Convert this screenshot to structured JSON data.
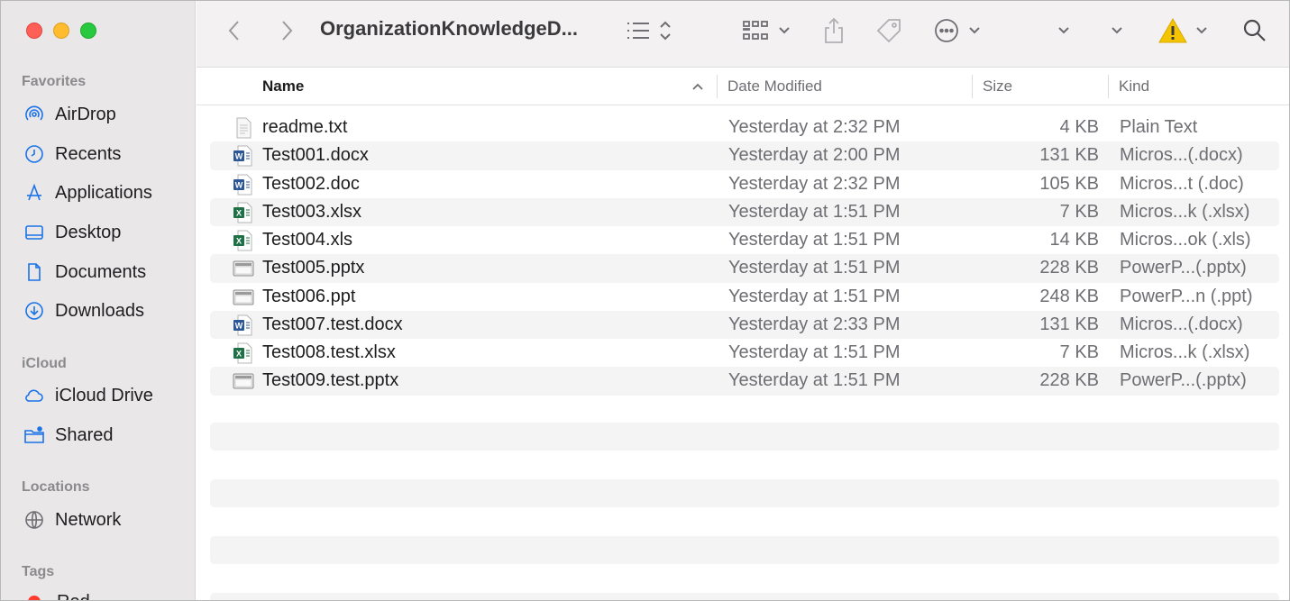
{
  "window": {
    "title": "OrganizationKnowledgeD..."
  },
  "sidebar": {
    "sections": [
      {
        "label": "Favorites"
      },
      {
        "label": "iCloud"
      },
      {
        "label": "Locations"
      },
      {
        "label": "Tags"
      }
    ],
    "favorites": [
      {
        "label": "AirDrop",
        "icon": "airdrop-icon"
      },
      {
        "label": "Recents",
        "icon": "clock-icon"
      },
      {
        "label": "Applications",
        "icon": "applications-icon"
      },
      {
        "label": "Desktop",
        "icon": "desktop-icon"
      },
      {
        "label": "Documents",
        "icon": "document-icon"
      },
      {
        "label": "Downloads",
        "icon": "download-icon"
      }
    ],
    "icloud": [
      {
        "label": "iCloud Drive",
        "icon": "cloud-icon"
      },
      {
        "label": "Shared",
        "icon": "shared-folder-icon"
      }
    ],
    "locations": [
      {
        "label": "Network",
        "icon": "globe-icon"
      }
    ],
    "tags": [
      {
        "label": "Red",
        "color": "#ff3b30"
      }
    ]
  },
  "columns": {
    "name": "Name",
    "date": "Date Modified",
    "size": "Size",
    "kind": "Kind"
  },
  "files": [
    {
      "name": "readme.txt",
      "date": "Yesterday at 2:32 PM",
      "size": "4 KB",
      "kind": "Plain Text",
      "icon": "text-file-icon"
    },
    {
      "name": "Test001.docx",
      "date": "Yesterday at 2:00 PM",
      "size": "131 KB",
      "kind": "Micros...(.docx)",
      "icon": "word-file-icon"
    },
    {
      "name": "Test002.doc",
      "date": "Yesterday at 2:32 PM",
      "size": "105 KB",
      "kind": "Micros...t (.doc)",
      "icon": "word-file-icon"
    },
    {
      "name": "Test003.xlsx",
      "date": "Yesterday at 1:51 PM",
      "size": "7 KB",
      "kind": "Micros...k (.xlsx)",
      "icon": "excel-file-icon"
    },
    {
      "name": "Test004.xls",
      "date": "Yesterday at 1:51 PM",
      "size": "14 KB",
      "kind": "Micros...ok (.xls)",
      "icon": "excel-file-icon"
    },
    {
      "name": "Test005.pptx",
      "date": "Yesterday at 1:51 PM",
      "size": "228 KB",
      "kind": "PowerP...(.pptx)",
      "icon": "powerpoint-file-icon"
    },
    {
      "name": "Test006.ppt",
      "date": "Yesterday at 1:51 PM",
      "size": "248 KB",
      "kind": "PowerP...n (.ppt)",
      "icon": "powerpoint-file-icon"
    },
    {
      "name": "Test007.test.docx",
      "date": "Yesterday at 2:33 PM",
      "size": "131 KB",
      "kind": "Micros...(.docx)",
      "icon": "word-file-icon"
    },
    {
      "name": "Test008.test.xlsx",
      "date": "Yesterday at 1:51 PM",
      "size": "7 KB",
      "kind": "Micros...k (.xlsx)",
      "icon": "excel-file-icon"
    },
    {
      "name": "Test009.test.pptx",
      "date": "Yesterday at 1:51 PM",
      "size": "228 KB",
      "kind": "PowerP...(.pptx)",
      "icon": "powerpoint-file-icon"
    }
  ],
  "colors": {
    "sidebar_bg": "#e9e7e8",
    "accent_icon": "#1a73e8",
    "warning": "#f5c400"
  }
}
